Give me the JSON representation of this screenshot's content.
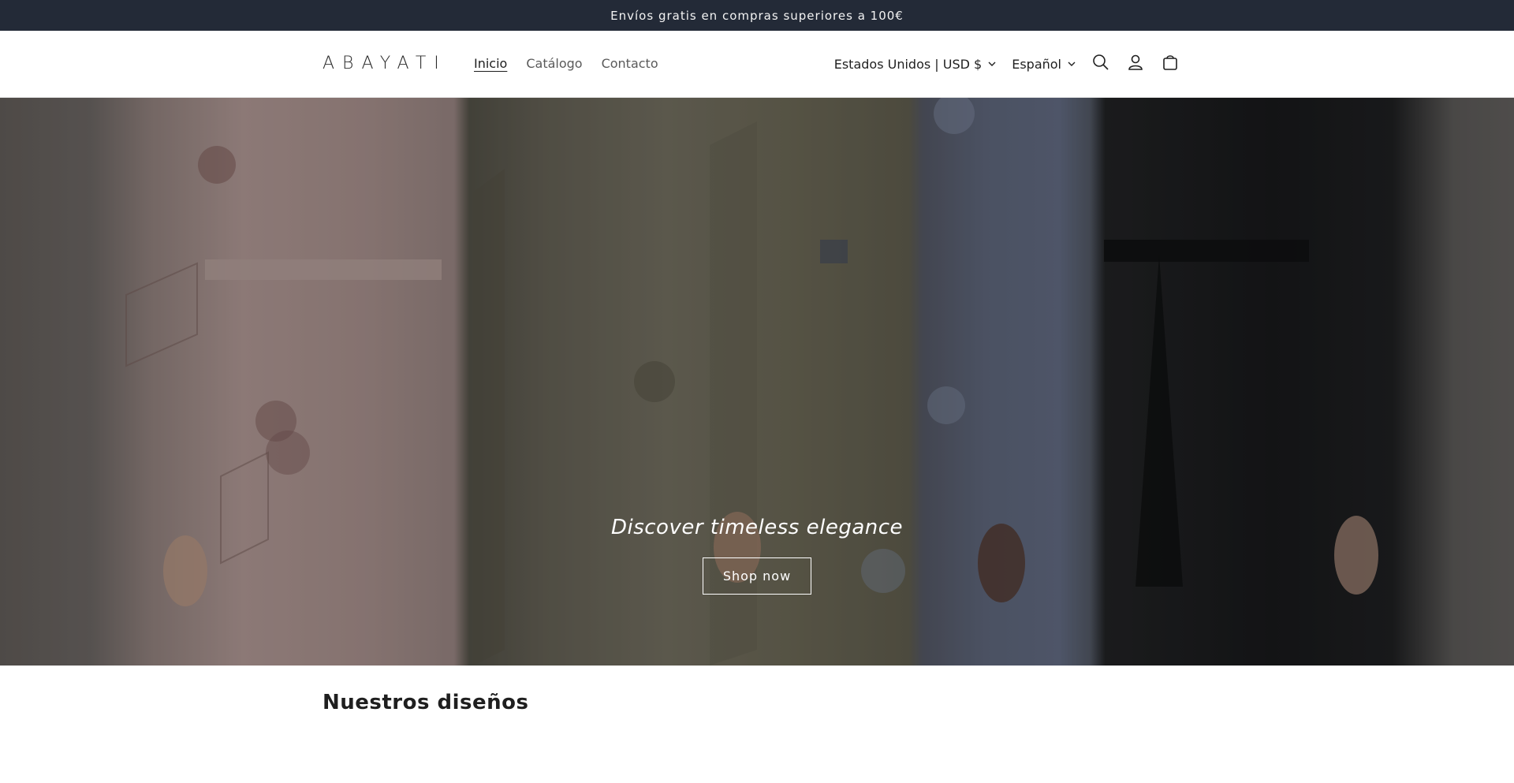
{
  "announcement": {
    "text": "Envíos gratis en compras superiores a 100€"
  },
  "header": {
    "logo": "ABAYATI",
    "nav": [
      {
        "label": "Inicio",
        "active": true
      },
      {
        "label": "Catálogo",
        "active": false
      },
      {
        "label": "Contacto",
        "active": false
      }
    ],
    "country_selector": "Estados Unidos | USD $",
    "language_selector": "Español",
    "icons": [
      "search-icon",
      "account-icon",
      "cart-icon"
    ]
  },
  "hero": {
    "title": "Discover timeless elegance",
    "button_label": "Shop now"
  },
  "section": {
    "title": "Nuestros diseños"
  },
  "colors": {
    "announcement_bg": "#232a37",
    "text": "#121212",
    "white": "#ffffff"
  }
}
